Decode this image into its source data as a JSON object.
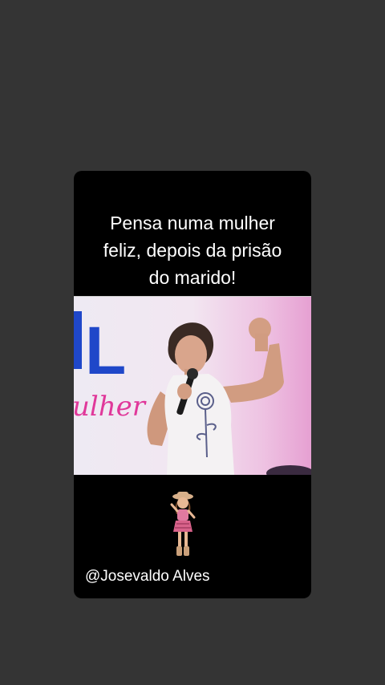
{
  "post": {
    "caption": "Pensa numa mulher\nfeliz, depois da prisão\ndo marido!",
    "banner_text_partial": "L",
    "banner_script_partial": "ulher",
    "handle": "@Josevaldo Alves"
  },
  "colors": {
    "background": "#343434",
    "card": "#000000",
    "text": "#ffffff",
    "banner_blue": "#1f47c9",
    "banner_pink": "#e0389a"
  },
  "icons": {
    "sticker": "dancing-cowgirl-sticker"
  }
}
